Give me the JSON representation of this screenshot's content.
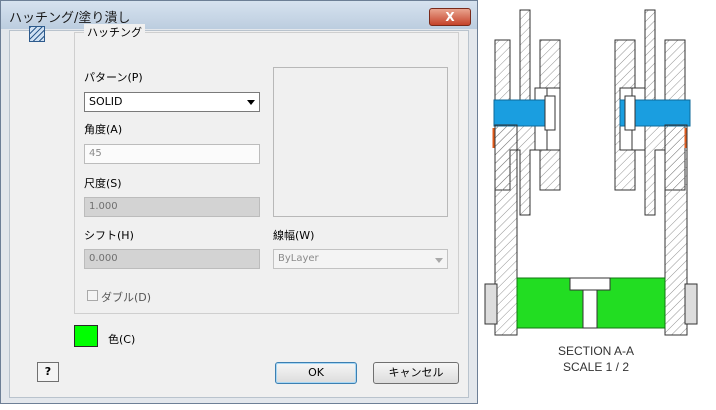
{
  "dialog": {
    "title": "ハッチング/塗り潰し",
    "close_glyph": "X",
    "group_title": "ハッチング",
    "pattern": {
      "label": "パターン(P)",
      "value": "SOLID"
    },
    "angle": {
      "label": "角度(A)",
      "value": "45"
    },
    "scale": {
      "label": "尺度(S)",
      "value": "1.000"
    },
    "shift": {
      "label": "シフト(H)",
      "value": "0.000"
    },
    "lineweight": {
      "label": "線幅(W)",
      "value": "ByLayer"
    },
    "double": {
      "label": "ダブル(D)",
      "checked": false
    },
    "color": {
      "label": "色(C)",
      "swatch": "#00ff00"
    },
    "ok_label": "OK",
    "cancel_label": "キャンセル",
    "help_glyph": "?"
  },
  "drawing": {
    "section_label": "SECTION A-A",
    "scale_label": "SCALE 1 / 2",
    "colors": {
      "blue": "#1a9ee0",
      "green": "#22dd22",
      "orange": "#e05a1a"
    }
  }
}
